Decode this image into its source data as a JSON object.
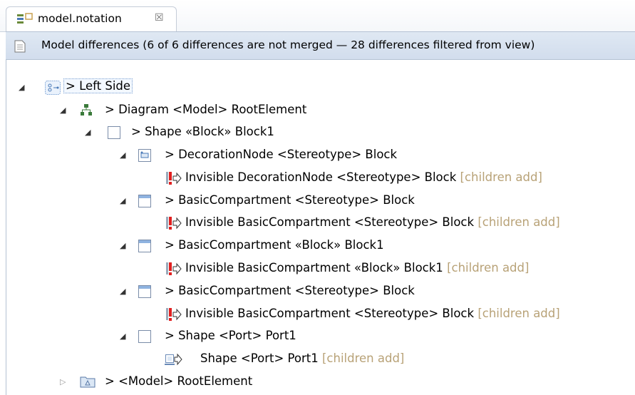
{
  "tab": {
    "title": "model.notation",
    "close": "☒"
  },
  "infobar": {
    "text": "Model differences  (6 of 6 differences are not merged — 28 differences filtered from view)"
  },
  "tree": [
    {
      "label": "> Left Side",
      "icon": "match-icon",
      "toggle": "expanded"
    },
    {
      "label": "> Diagram <Model> RootElement",
      "icon": "diagram-icon",
      "toggle": "expanded"
    },
    {
      "label": "> Shape «Block» Block1",
      "icon": "shape-icon",
      "toggle": "expanded"
    },
    {
      "label": "> DecorationNode <Stereotype> Block",
      "icon": "decoration-node-icon",
      "toggle": "expanded"
    },
    {
      "label": "Invisible DecorationNode <Stereotype> Block",
      "suffix": "[children add]",
      "icon": "conflict-add-icon"
    },
    {
      "label": "> BasicCompartment <Stereotype> Block",
      "icon": "compartment-icon",
      "toggle": "expanded"
    },
    {
      "label": "Invisible BasicCompartment <Stereotype> Block",
      "suffix": "[children add]",
      "icon": "conflict-add-icon"
    },
    {
      "label": "> BasicCompartment «Block» Block1",
      "icon": "compartment-icon",
      "toggle": "expanded"
    },
    {
      "label": "Invisible BasicCompartment «Block» Block1",
      "suffix": "[children add]",
      "icon": "conflict-add-icon"
    },
    {
      "label": "> BasicCompartment <Stereotype> Block",
      "icon": "compartment-icon",
      "toggle": "expanded"
    },
    {
      "label": "Invisible BasicCompartment <Stereotype> Block",
      "suffix": "[children add]",
      "icon": "conflict-add-icon"
    },
    {
      "label": "> Shape <Port> Port1",
      "icon": "shape-icon",
      "toggle": "expanded"
    },
    {
      "label": "Shape <Port> Port1",
      "suffix": "[children add]",
      "icon": "shape-add-icon"
    },
    {
      "label": "> <Model> RootElement",
      "icon": "model-icon",
      "toggle": "collapsed"
    }
  ],
  "colors": {
    "accent": "#b8a277",
    "conflict": "#e02020",
    "header_bg": "#d9e3f0"
  }
}
